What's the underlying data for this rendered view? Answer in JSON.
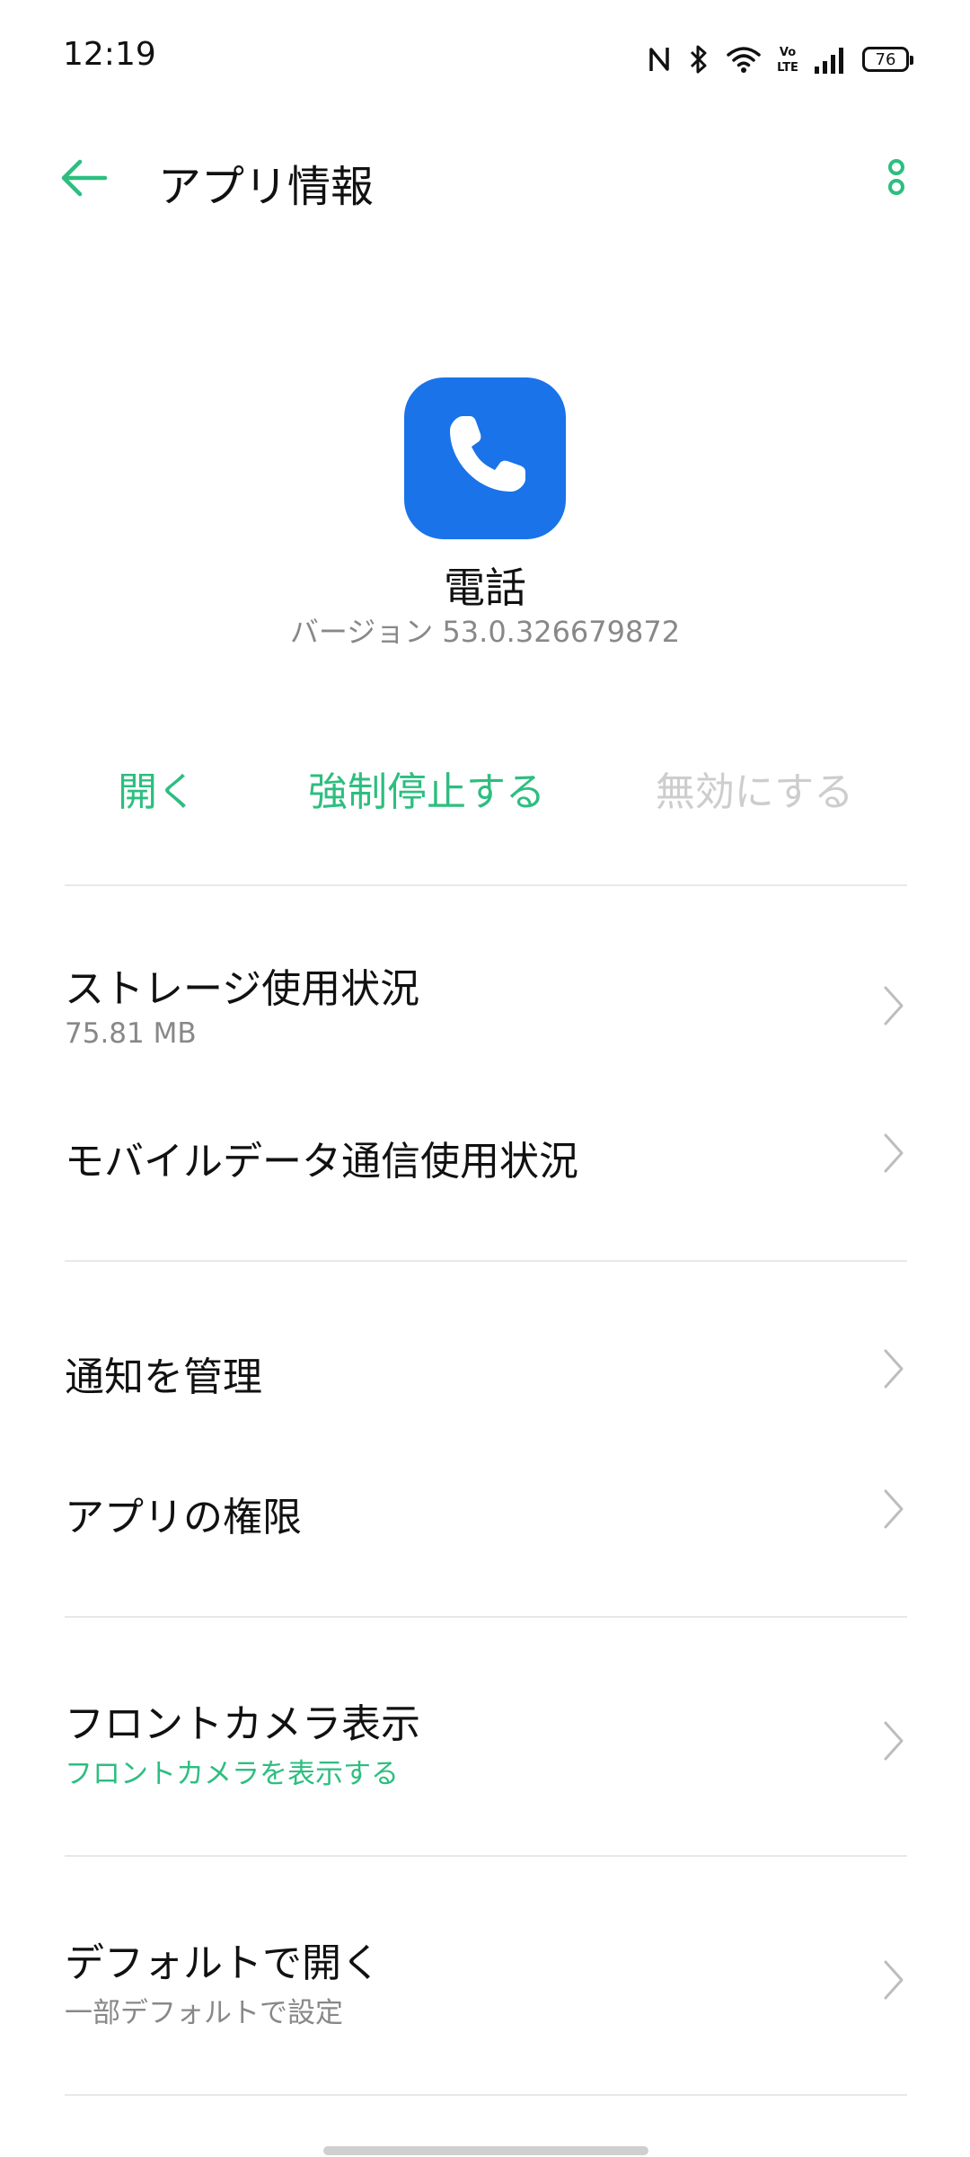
{
  "status_bar": {
    "time": "12:19",
    "battery": "76",
    "volte": "Vo LTE"
  },
  "app_bar": {
    "title": "アプリ情報"
  },
  "app": {
    "name": "電話",
    "version": "バージョン 53.0.326679872",
    "icon_color": "#1A73E8"
  },
  "actions": {
    "open": "開く",
    "force_stop": "強制停止する",
    "disable": "無効にする"
  },
  "rows": {
    "storage": {
      "title": "ストレージ使用状況",
      "subtitle": "75.81 MB"
    },
    "mobile_data": {
      "title": "モバイルデータ通信使用状況"
    },
    "notifications": {
      "title": "通知を管理"
    },
    "permissions": {
      "title": "アプリの権限"
    },
    "front_camera": {
      "title": "フロントカメラ表示",
      "subtitle": "フロントカメラを表示する"
    },
    "default_open": {
      "title": "デフォルトで開く",
      "subtitle": "一部デフォルトで設定"
    }
  },
  "colors": {
    "accent": "#2DBE80",
    "disabled": "#CDCDCD",
    "secondary_text": "#888888"
  },
  "icons": {
    "status": [
      "nfc-icon",
      "bluetooth-icon",
      "wifi-icon",
      "volte-icon",
      "signal-icon",
      "battery-icon"
    ],
    "app_bar": [
      "back-arrow-icon",
      "more-vert-icon"
    ],
    "app": "phone-icon",
    "row": "chevron-right-icon"
  }
}
